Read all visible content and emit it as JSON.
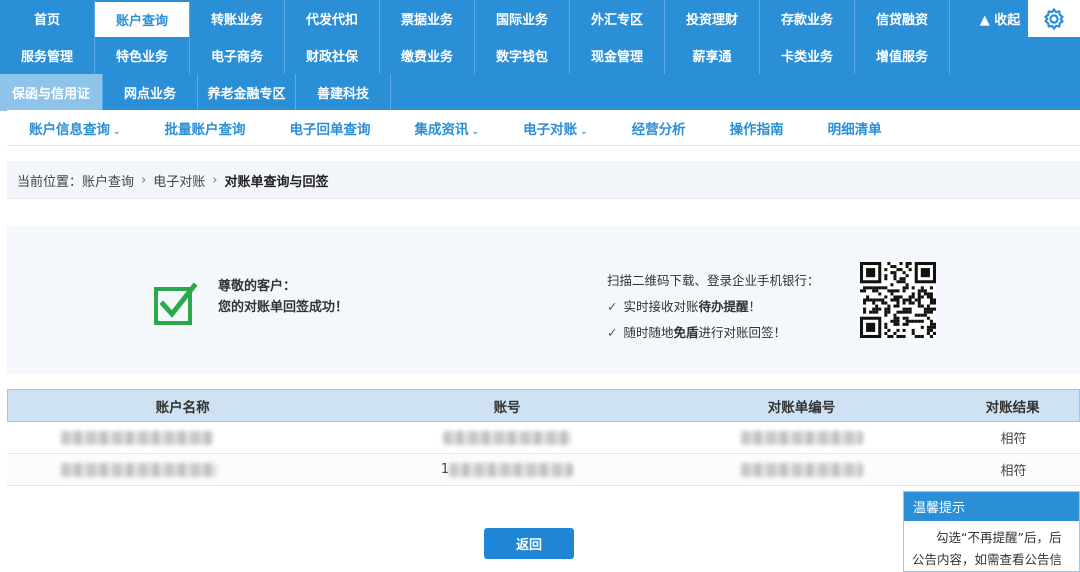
{
  "nav": {
    "row1": [
      "首页",
      "账户查询",
      "转账业务",
      "代发代扣",
      "票据业务",
      "国际业务",
      "外汇专区",
      "投资理财",
      "存款业务",
      "信贷融资"
    ],
    "row2": [
      "服务管理",
      "特色业务",
      "电子商务",
      "财政社保",
      "缴费业务",
      "数字钱包",
      "现金管理",
      "薪享通",
      "卡类业务",
      "增值服务"
    ],
    "row3": [
      "保函与信用证",
      "网点业务",
      "养老金融专区",
      "善建科技"
    ],
    "collapse_label": "▲ 收起",
    "settings_icon": "gear-icon"
  },
  "subnav": {
    "items": [
      {
        "label": "账户信息查询",
        "caret": "⌄"
      },
      {
        "label": "批量账户查询",
        "caret": ""
      },
      {
        "label": "电子回单查询",
        "caret": ""
      },
      {
        "label": "集成资讯",
        "caret": "⌄"
      },
      {
        "label": "电子对账",
        "caret": "⌄"
      },
      {
        "label": "经营分析",
        "caret": ""
      },
      {
        "label": "操作指南",
        "caret": ""
      },
      {
        "label": "明细清单",
        "caret": ""
      }
    ]
  },
  "breadcrumb": {
    "prefix": "当前位置：",
    "items": [
      "账户查询",
      "电子对账",
      "对账单查询与回签"
    ],
    "sep": "›"
  },
  "result": {
    "greeting": "尊敬的客户：",
    "message": "您的对账单回签成功！",
    "scan_title": "扫描二维码下载、登录企业手机银行：",
    "point1_pre": "实时接收对账",
    "point1_bold": "待办提醒",
    "point1_post": "！",
    "point2_pre": "随时随地",
    "point2_bold": "免盾",
    "point2_post": "进行对账回签！",
    "tick": "✓",
    "accent": "#2ba84a"
  },
  "table": {
    "headers": [
      "账户名称",
      "账号",
      "对账单编号",
      "对账结果"
    ],
    "rows": [
      {
        "account_no_prefix": "",
        "statement_prefix": "",
        "result": "相符"
      },
      {
        "account_no_prefix": "1",
        "statement_prefix": "",
        "result": "相符"
      }
    ]
  },
  "back_button": "返回",
  "tip": {
    "title": "温馨提示",
    "body": "勾选“不再提醒”后，后公告内容，如需查看公告信息"
  },
  "colors": {
    "primary": "#2b8fd8",
    "header_bg": "#cfe2f3"
  }
}
